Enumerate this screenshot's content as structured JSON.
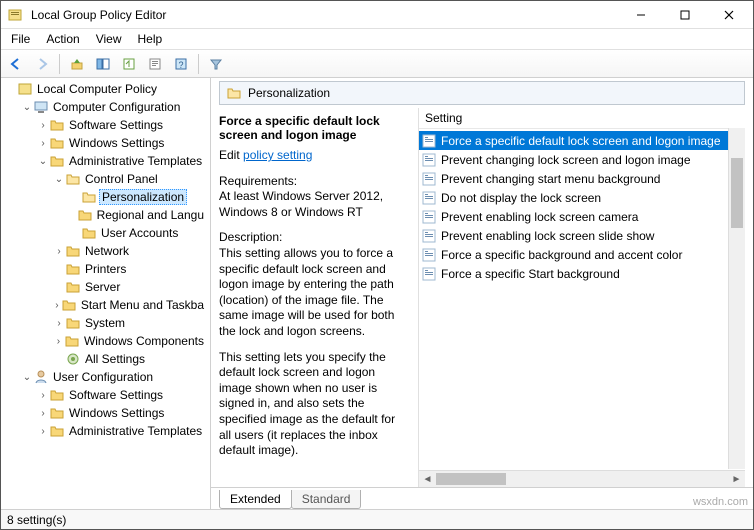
{
  "window": {
    "title": "Local Group Policy Editor"
  },
  "menu": {
    "file": "File",
    "action": "Action",
    "view": "View",
    "help": "Help"
  },
  "tree": {
    "root": "Local Computer Policy",
    "cc": "Computer Configuration",
    "ss": "Software Settings",
    "ws": "Windows Settings",
    "at": "Administrative Templates",
    "cp": "Control Panel",
    "pers": "Personalization",
    "regl": "Regional and Langu",
    "ua": "User Accounts",
    "net": "Network",
    "prn": "Printers",
    "srv": "Server",
    "smt": "Start Menu and Taskba",
    "sys": "System",
    "wc": "Windows Components",
    "allset": "All Settings",
    "uc": "User Configuration",
    "uss": "Software Settings",
    "uws": "Windows Settings",
    "uat": "Administrative Templates"
  },
  "breadcrumb": {
    "label": "Personalization"
  },
  "desc": {
    "title": "Force a specific default lock screen and logon image",
    "edit_prefix": "Edit",
    "edit_link": "policy setting",
    "req_label": "Requirements:",
    "req_body": "At least Windows Server 2012, Windows 8 or Windows RT",
    "d_label": "Description:",
    "d_body1": "This setting allows you to force a specific default lock screen and logon image by entering the path (location) of the image file. The same image will be used for both the lock and logon screens.",
    "d_body2": "This setting lets you specify the default lock screen and logon image shown when no user is signed in, and also sets the specified image as the default for all users (it replaces the inbox default image)."
  },
  "settings": {
    "header": "Setting",
    "items": [
      "Force a specific default lock screen and logon image",
      "Prevent changing lock screen and logon image",
      "Prevent changing start menu background",
      "Do not display the lock screen",
      "Prevent enabling lock screen camera",
      "Prevent enabling lock screen slide show",
      "Force a specific background and accent color",
      "Force a specific Start background"
    ]
  },
  "tabs": {
    "extended": "Extended",
    "standard": "Standard"
  },
  "status": {
    "text": "8 setting(s)"
  },
  "watermark": "wsxdn.com"
}
